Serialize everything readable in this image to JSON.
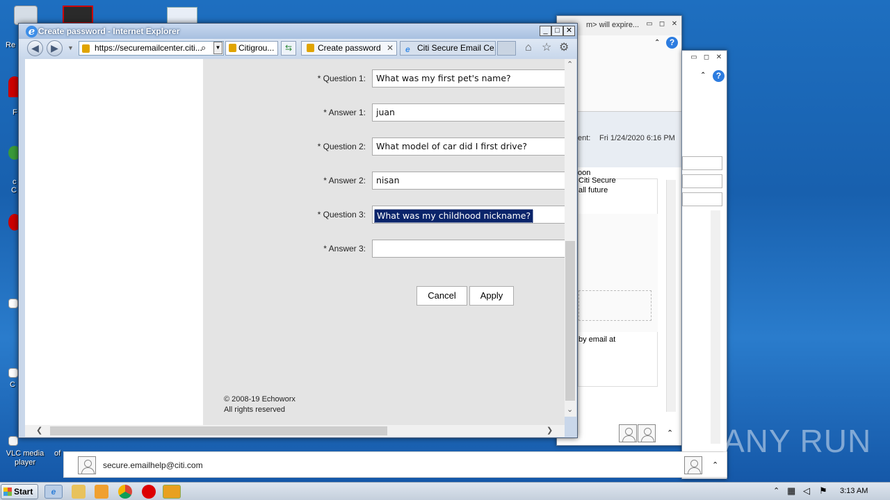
{
  "desktop": {
    "icons": [
      {
        "label": "Re"
      },
      {
        "label": "F"
      },
      {
        "label": "c"
      },
      {
        "label": "C"
      },
      {
        "label": "C"
      },
      {
        "label": "VLC media player"
      },
      {
        "label": "of"
      }
    ]
  },
  "outlook_back": {
    "title_fragment": "m> will expire...",
    "sent_label": "ent:",
    "sent_value": "Fri 1/24/2020 6:16 PM",
    "body_fragments": [
      "oon",
      "Citi Secure",
      "all future",
      "by email at"
    ]
  },
  "ie": {
    "window_title": "Create password - Internet Explorer",
    "address": "https://securemailcenter.citi...",
    "site_tab": "Citigrou...",
    "tabs": [
      {
        "label": "Create password",
        "active": true
      },
      {
        "label": "Citi Secure Email Ce...",
        "active": false
      }
    ],
    "form": {
      "question1_label": "* Question 1:",
      "question1_value": "What was my first pet's name?",
      "answer1_label": "* Answer 1:",
      "answer1_value": "juan",
      "question2_label": "* Question 2:",
      "question2_value": "What model of car did I first drive?",
      "answer2_label": "* Answer 2:",
      "answer2_value": "nisan",
      "question3_label": "* Question 3:",
      "question3_value": "What was my childhood nickname?",
      "answer3_label": "* Answer 3:",
      "answer3_value": "",
      "cancel_label": "Cancel",
      "apply_label": "Apply"
    },
    "footer": {
      "copyright": "© 2008-19 Echoworx",
      "rights": "All rights reserved"
    }
  },
  "people_pane": {
    "email": "secure.emailhelp@citi.com"
  },
  "taskbar": {
    "start_label": "Start",
    "clock": "3:13 AM"
  },
  "watermark": "ANY RUN"
}
